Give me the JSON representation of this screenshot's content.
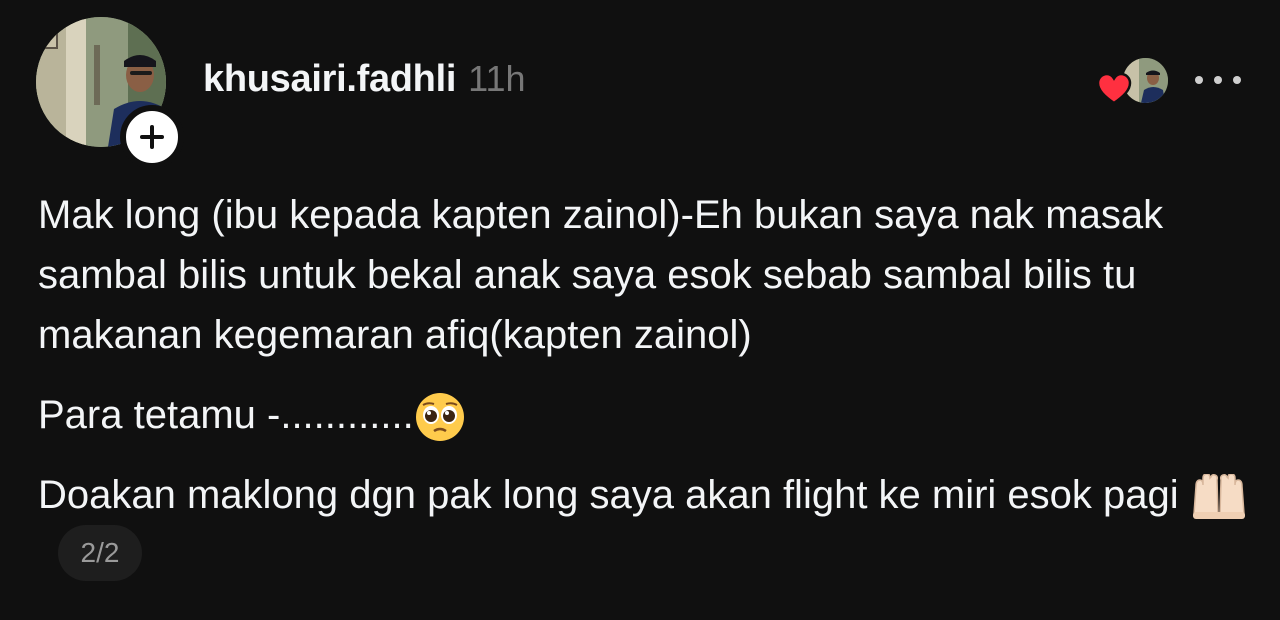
{
  "post": {
    "username": "khusairi.fadhli",
    "time_ago": "11h",
    "icons": {
      "follow": "plus-icon",
      "liked": "heart-icon",
      "more": "more-horizontal-icon"
    },
    "colors": {
      "background": "#101010",
      "text": "#f3f5f7",
      "muted": "#777777",
      "heart": "#ff3040",
      "pill_bg": "#1e1e1e"
    },
    "body": {
      "paragraph1": "Mak long (ibu kepada kapten zainol)-Eh bukan saya nak masak sambal bilis untuk bekal anak saya esok sebab sambal bilis tu makanan kegemaran afiq(kapten zainol)",
      "paragraph2": "Para tetamu -............",
      "paragraph3": "Doakan maklong dgn pak long saya akan flight ke miri esok pagi"
    },
    "emojis": {
      "pleading": "pleading-face-emoji",
      "hands": "palms-up-together-emoji"
    },
    "page_indicator": "2/2"
  }
}
